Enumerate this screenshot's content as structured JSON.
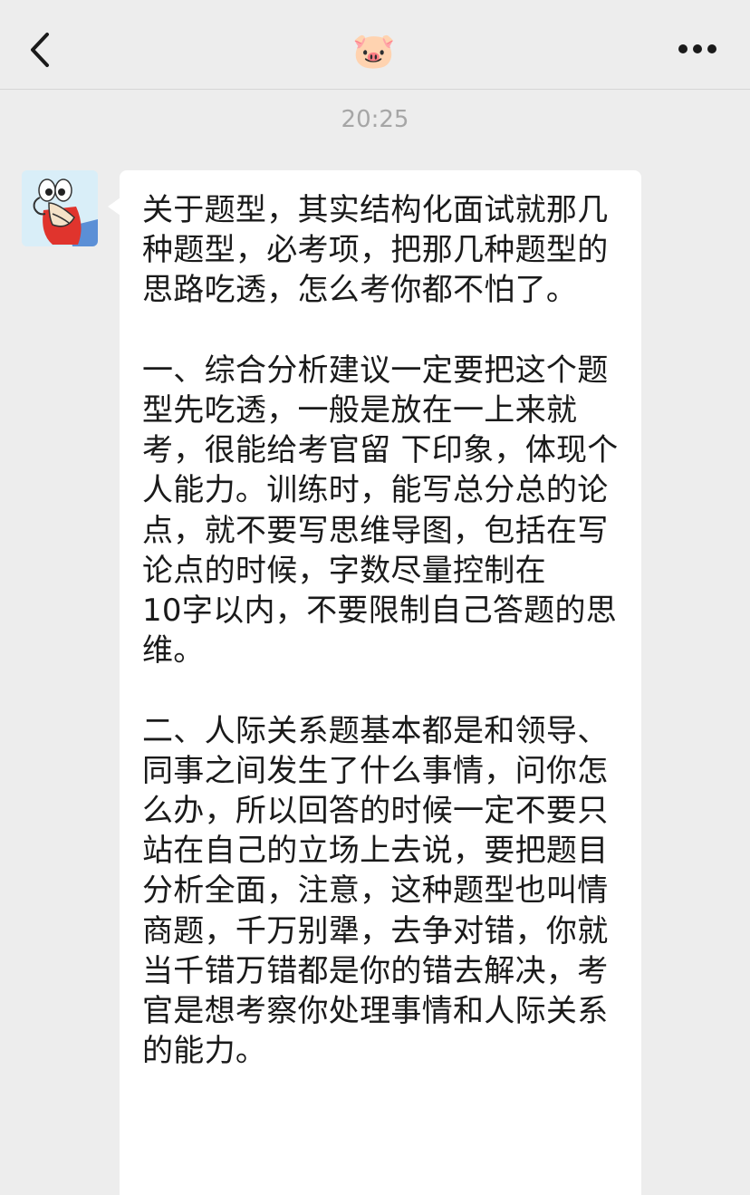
{
  "navbar": {
    "title_emoji": "🐷",
    "back_icon": "chevron-left-icon",
    "more_icon": "ellipsis-icon"
  },
  "chat": {
    "timestamp": "20:25",
    "message": {
      "avatar": "cartoon-crab-avatar",
      "text": "关于题型，其实结构化面试就那几种题型，必考项，把那几种题型的思路吃透，怎么考你都不怕了。\n\n一、综合分析建议一定要把这个题型先吃透，一般是放在一上来就考，很能给考官留 下印象，体现个人能力。训练时，能写总分总的论点，就不要写思维导图，包括在写论点的时候，字数尽量控制在\n10字以内，不要限制自己答题的思维。\n\n二、人际关系题基本都是和领导、同事之间发生了什么事情，问你怎么办，所以回答的时候一定不要只站在自己的立场上去说，要把题目分析全面，注意，这种题型也叫情商题，千万别犟，去争对错，你就当千错万错都是你的错去解决，考官是想考察你处理事情和人际关系的能力。"
    }
  },
  "colors": {
    "background": "#ededed",
    "bubble": "#ffffff",
    "text": "#1a1a1a",
    "timestamp": "#a6a6a6"
  }
}
